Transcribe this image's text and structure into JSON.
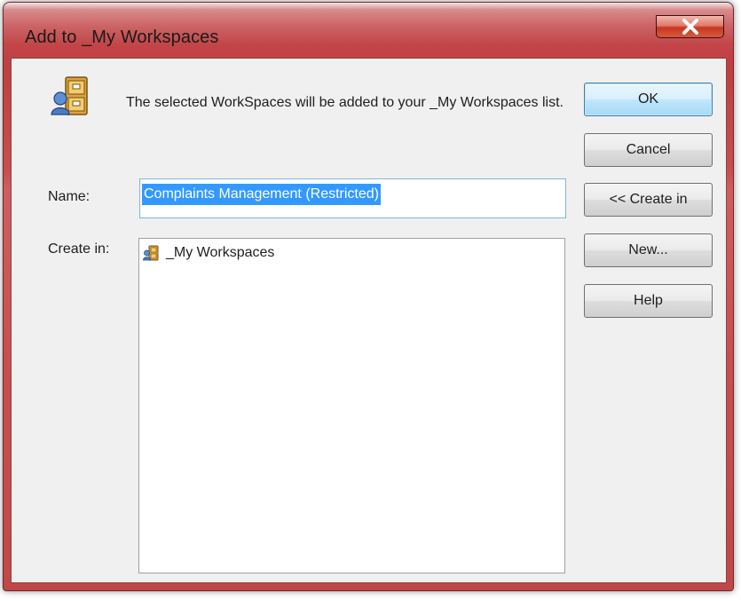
{
  "window": {
    "title": "Add to _My Workspaces"
  },
  "dialog": {
    "message": "The selected WorkSpaces will be added to your _My Workspaces list.",
    "name_label": "Name:",
    "name_value": "Complaints Management (Restricted)",
    "create_in_label": "Create in:",
    "tree_items": [
      {
        "label": "_My Workspaces",
        "icon": "workspace-cabinet-icon"
      }
    ]
  },
  "buttons": {
    "ok": "OK",
    "cancel": "Cancel",
    "create_in": "<< Create in",
    "new": "New...",
    "help": "Help"
  },
  "colors": {
    "title_bar": "#c24547",
    "close_button": "#c7371f",
    "selection_highlight": "#3399ff",
    "default_button_border": "#3c7fb1"
  }
}
